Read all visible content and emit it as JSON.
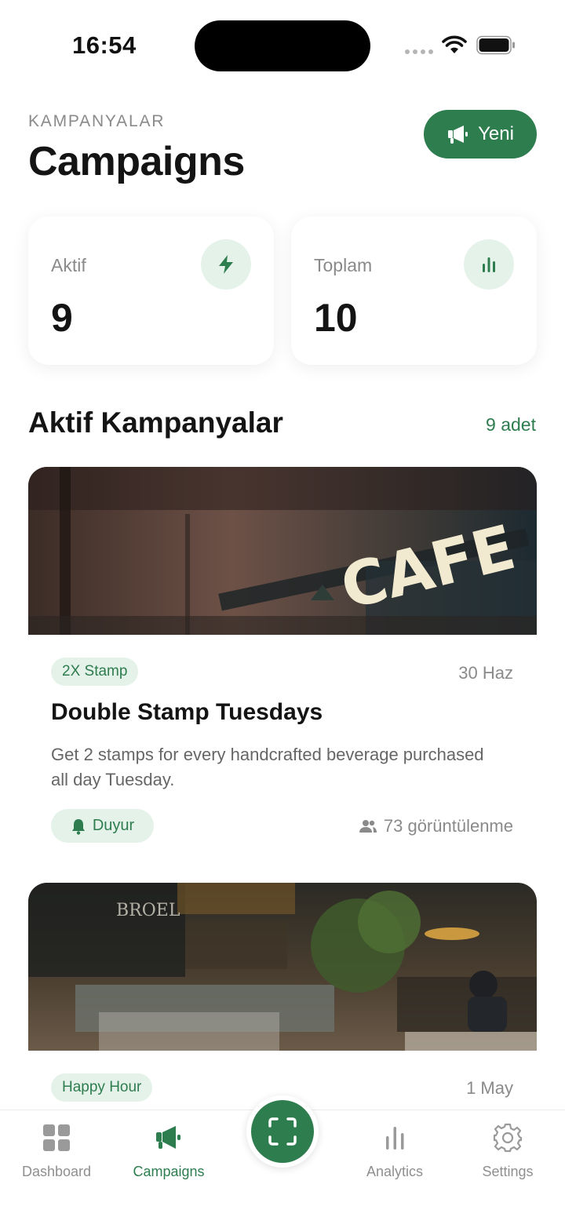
{
  "status_bar": {
    "time": "16:54"
  },
  "header": {
    "eyebrow": "KAMPANYALAR",
    "title": "Campaigns",
    "new_button_label": "Yeni",
    "new_button_icon": "megaphone-icon"
  },
  "stats": [
    {
      "label": "Aktif",
      "value": "9",
      "icon": "bolt-icon"
    },
    {
      "label": "Toplam",
      "value": "10",
      "icon": "bar-chart-icon"
    }
  ],
  "section": {
    "title": "Aktif Kampanyalar",
    "count": "9 adet"
  },
  "campaigns": [
    {
      "tag": "2X Stamp",
      "date": "30 Haz",
      "title": "Double Stamp Tuesdays",
      "description": "Get 2 stamps for every handcrafted beverage purchased all day Tuesday.",
      "notify_label": "Duyur",
      "views": "73 görüntülenme",
      "image_sign_text": "CAFE"
    },
    {
      "tag": "Happy Hour",
      "date": "1 May",
      "image_sign_text": "BROEL"
    }
  ],
  "tab_bar": {
    "items": [
      {
        "label": "Dashboard",
        "icon": "grid-icon"
      },
      {
        "label": "Campaigns",
        "icon": "megaphone-icon",
        "active": true
      },
      {
        "label": "Analytics",
        "icon": "bar-chart-icon"
      },
      {
        "label": "Settings",
        "icon": "gear-icon"
      }
    ],
    "center_icon": "scan-icon"
  },
  "colors": {
    "accent": "#2e7d4f",
    "accent_soft": "#e5f2ea",
    "muted_text": "#8a8a8a"
  }
}
